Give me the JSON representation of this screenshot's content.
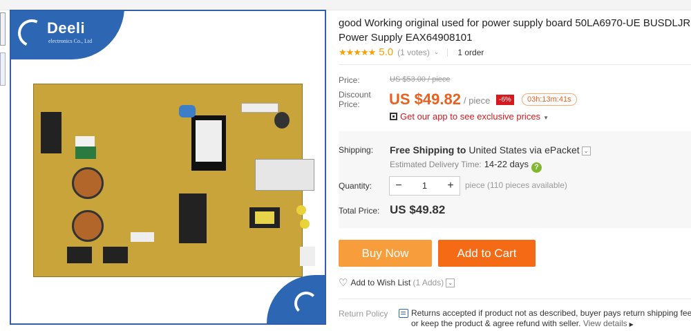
{
  "gallery": {
    "brand": "Deeli",
    "brand_sub": "electronics Co., Ltd"
  },
  "product": {
    "title_line1": "good Working original used for power supply board 50LA6970-UE BUSDLJR",
    "title_line2": "Power Supply EAX64908101",
    "stars": "★★★★★",
    "rating": "5.0",
    "votes": "(1 votes)",
    "orders": "1 order"
  },
  "price": {
    "price_label": "Price:",
    "old_price": "US $53.00 / piece",
    "discount_label_1": "Discount",
    "discount_label_2": "Price:",
    "current_price": "US $49.82",
    "unit": "/ piece",
    "discount_pct": "-6%",
    "countdown": "03h:13m:41s",
    "app_promo": "Get our app to see exclusive prices"
  },
  "shipping": {
    "label": "Shipping:",
    "free_text": "Free Shipping to",
    "destination": "United States via ePacket",
    "est_label": "Estimated Delivery Time:",
    "est_value": "14-22 days"
  },
  "quantity": {
    "label": "Quantity:",
    "minus": "−",
    "value": "1",
    "plus": "+",
    "available": "piece (110 pieces available)"
  },
  "total": {
    "label": "Total Price:",
    "value": "US $49.82"
  },
  "actions": {
    "buy_now": "Buy Now",
    "add_to_cart": "Add to Cart",
    "wish_label": "Add to Wish List",
    "wish_count": "(1 Adds)"
  },
  "return_policy": {
    "label": "Return Policy",
    "line1": "Returns accepted if product not as described, buyer pays return shipping fee;",
    "line2": "or keep the product & agree refund with seller.",
    "view_details": "View details"
  },
  "colors": {
    "accent_orange": "#e9611f",
    "buy_now": "#f89d3b",
    "add_to_cart": "#f46a15",
    "discount_badge": "#d7181d",
    "brand_blue": "#2d66b2"
  }
}
